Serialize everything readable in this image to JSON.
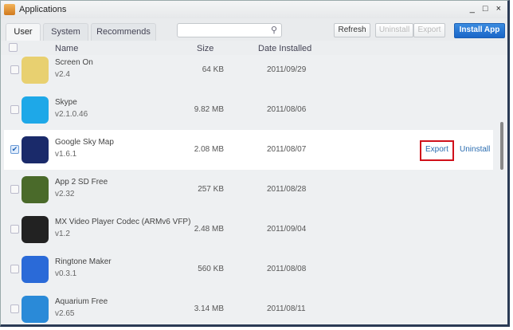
{
  "window": {
    "title": "Applications",
    "controls": [
      "_",
      "□",
      "×"
    ]
  },
  "tabs": [
    {
      "label": "User",
      "active": true
    },
    {
      "label": "System"
    },
    {
      "label": "Recommends"
    }
  ],
  "search": {
    "placeholder": ""
  },
  "toolbar": {
    "refresh": "Refresh",
    "uninstall": "Uninstall",
    "export": "Export",
    "install": "Install App"
  },
  "columns": {
    "name": "Name",
    "size": "Size",
    "date": "Date Installed"
  },
  "apps": [
    {
      "name": "Screen On",
      "version": "v2.4",
      "size": "64 KB",
      "date": "2011/09/29",
      "checked": false,
      "color": "#e8d070"
    },
    {
      "name": "Skype",
      "version": "v2.1.0.46",
      "size": "9.82 MB",
      "date": "2011/08/06",
      "checked": false,
      "color": "#1ea8e8"
    },
    {
      "name": "Google Sky Map",
      "version": "v1.6.1",
      "size": "2.08 MB",
      "date": "2011/08/07",
      "checked": true,
      "color": "#1a2a6a",
      "actions": {
        "export": "Export",
        "uninstall": "Uninstall"
      }
    },
    {
      "name": "App 2 SD Free",
      "version": "v2.32",
      "size": "257 KB",
      "date": "2011/08/28",
      "checked": false,
      "color": "#4a6a2a"
    },
    {
      "name": "MX Video Player Codec (ARMv6 VFP)",
      "version": "v1.2",
      "size": "2.48 MB",
      "date": "2011/09/04",
      "checked": false,
      "color": "#222"
    },
    {
      "name": "Ringtone Maker",
      "version": "v0.3.1",
      "size": "560 KB",
      "date": "2011/08/08",
      "checked": false,
      "color": "#2a6ad8"
    },
    {
      "name": "Aquarium Free",
      "version": "v2.65",
      "size": "3.14 MB",
      "date": "2011/08/11",
      "checked": false,
      "color": "#2a8ad8"
    }
  ]
}
